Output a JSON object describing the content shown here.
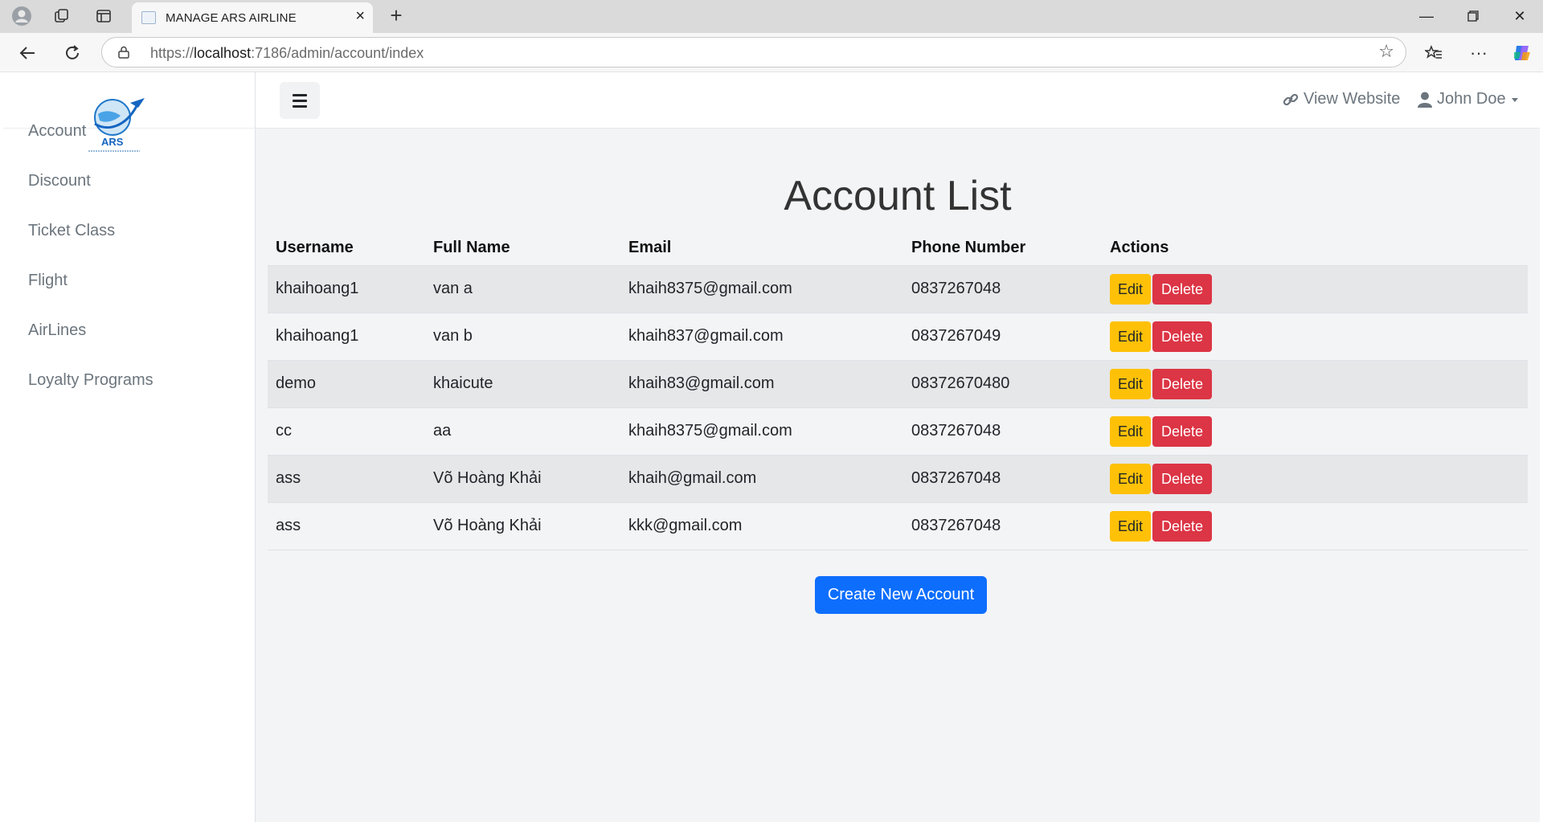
{
  "browser": {
    "tab_title": "MANAGE ARS AIRLINE",
    "url_prefix": "https://",
    "url_host": "localhost",
    "url_rest": ":7186/admin/account/index"
  },
  "sidebar": {
    "logo_text": "ARS",
    "items": [
      {
        "label": "Account"
      },
      {
        "label": "Discount"
      },
      {
        "label": "Ticket Class"
      },
      {
        "label": "Flight"
      },
      {
        "label": "AirLines"
      },
      {
        "label": "Loyalty Programs"
      }
    ]
  },
  "topbar": {
    "view_website": "View Website",
    "user_name": "John Doe"
  },
  "main": {
    "title": "Account List",
    "columns": [
      "Username",
      "Full Name",
      "Email",
      "Phone Number",
      "Actions"
    ],
    "rows": [
      {
        "username": "khaihoang1",
        "full_name": "van a",
        "email": "khaih8375@gmail.com",
        "phone": "0837267048"
      },
      {
        "username": "khaihoang1",
        "full_name": "van b",
        "email": "khaih837@gmail.com",
        "phone": "0837267049"
      },
      {
        "username": "demo",
        "full_name": "khaicute",
        "email": "khaih83@gmail.com",
        "phone": "08372670480"
      },
      {
        "username": "cc",
        "full_name": "aa",
        "email": "khaih8375@gmail.com",
        "phone": "0837267048"
      },
      {
        "username": "ass",
        "full_name": "Võ Hoàng Khải",
        "email": "khaih@gmail.com",
        "phone": "0837267048"
      },
      {
        "username": "ass",
        "full_name": "Võ Hoàng Khải",
        "email": "kkk@gmail.com",
        "phone": "0837267048"
      }
    ],
    "edit_label": "Edit",
    "delete_label": "Delete",
    "create_label": "Create New Account"
  },
  "colors": {
    "edit": "#ffc107",
    "delete": "#dc3545",
    "primary": "#0d6efd"
  }
}
